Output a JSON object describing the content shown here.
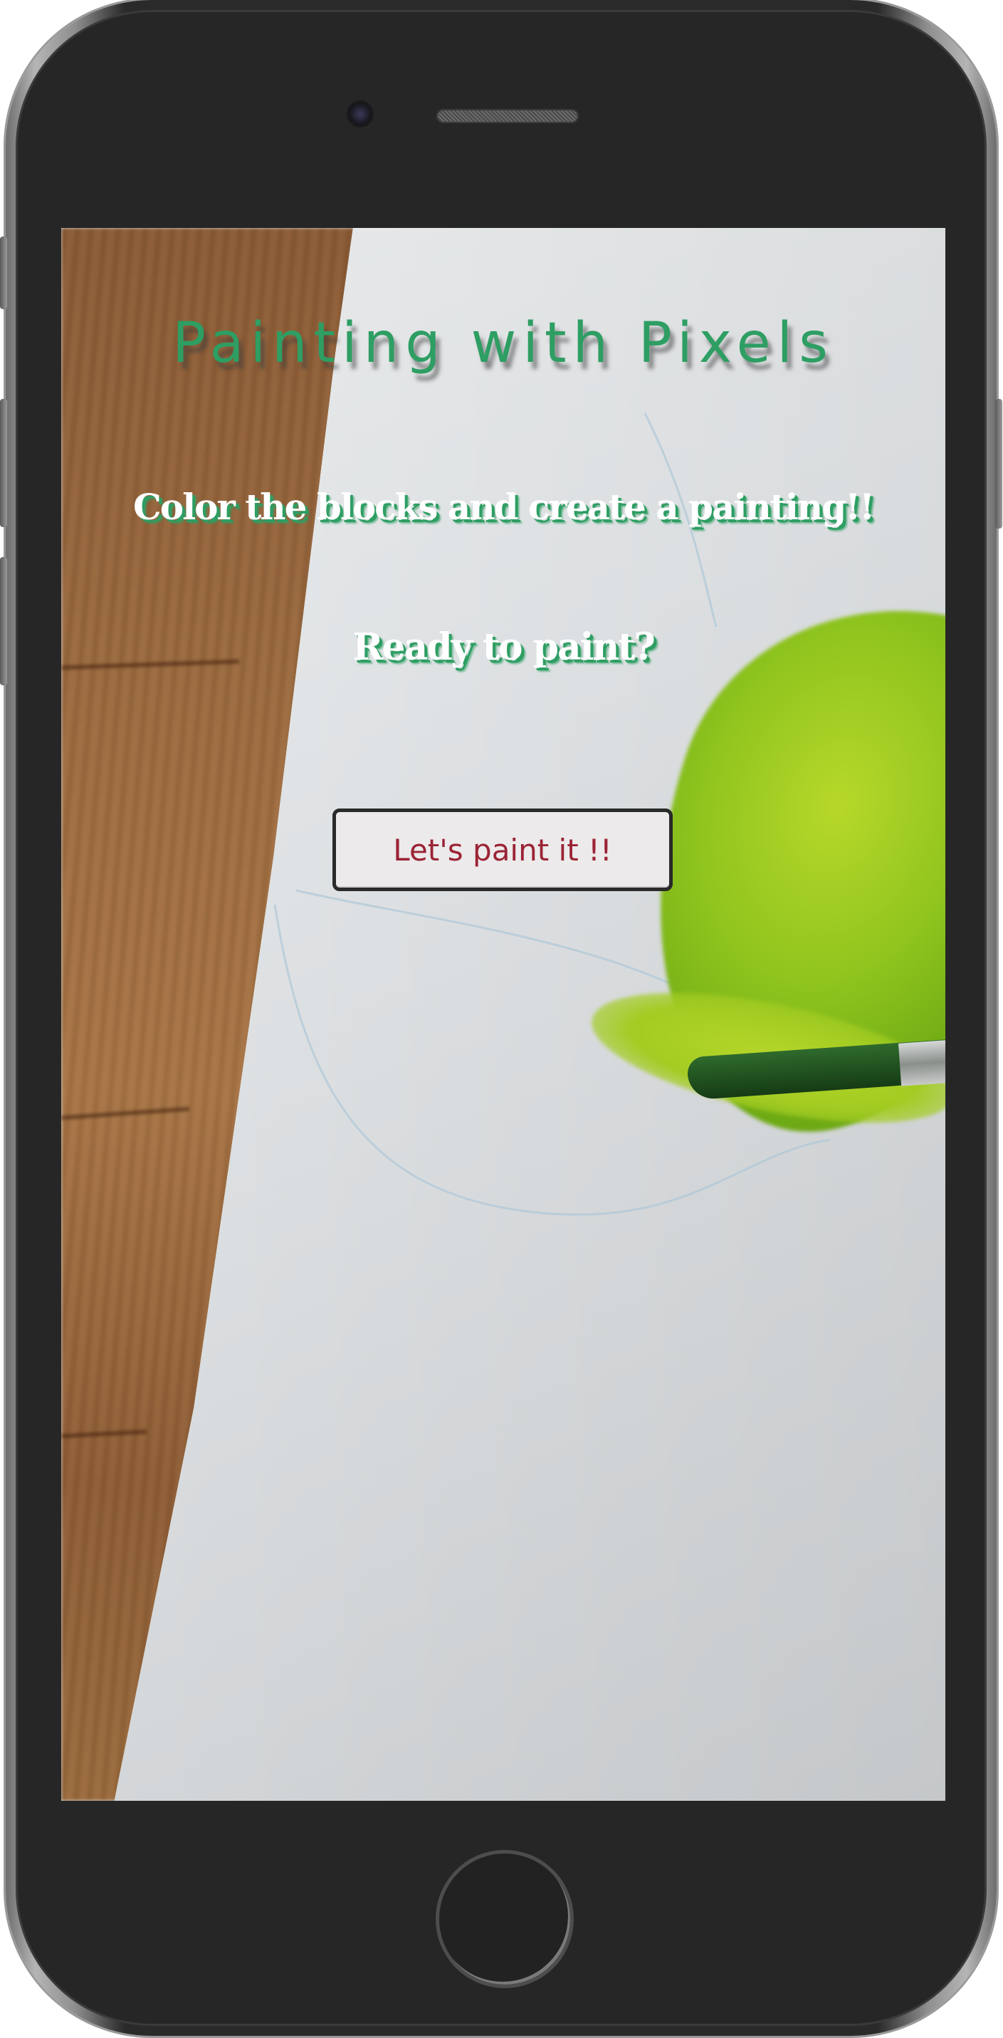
{
  "app": {
    "title": "Painting with Pixels",
    "subtitle": "Color the blocks and create a painting!!",
    "prompt": "Ready to paint?",
    "cta_label": "Let's paint it !!"
  },
  "colors": {
    "title_green": "#2e9e63",
    "button_text": "#9b2335",
    "button_bg": "#eceaea",
    "device_body": "#262626"
  },
  "icons": {
    "camera": "front-camera-icon",
    "speaker": "earpiece-speaker-icon",
    "home": "home-button-icon"
  }
}
